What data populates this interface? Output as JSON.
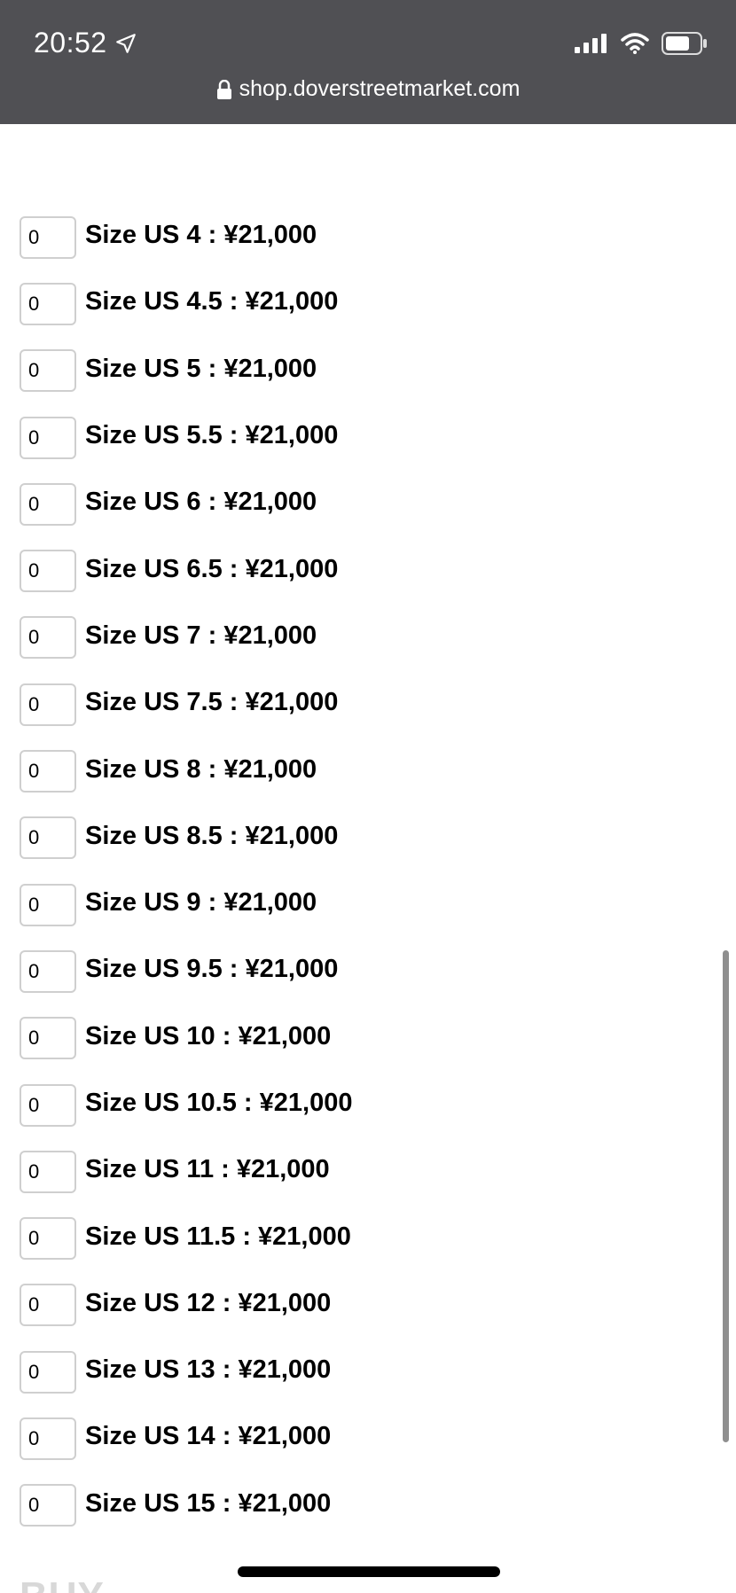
{
  "status_bar": {
    "time": "20:52"
  },
  "url_bar": {
    "url": "shop.doverstreetmarket.com"
  },
  "sizes": [
    {
      "qty": "0",
      "label": "Size US 4 : ¥21,000"
    },
    {
      "qty": "0",
      "label": "Size US 4.5 : ¥21,000"
    },
    {
      "qty": "0",
      "label": "Size US 5 : ¥21,000"
    },
    {
      "qty": "0",
      "label": "Size US 5.5 : ¥21,000"
    },
    {
      "qty": "0",
      "label": "Size US 6 : ¥21,000"
    },
    {
      "qty": "0",
      "label": "Size US 6.5 : ¥21,000"
    },
    {
      "qty": "0",
      "label": "Size US 7 : ¥21,000"
    },
    {
      "qty": "0",
      "label": "Size US 7.5 : ¥21,000"
    },
    {
      "qty": "0",
      "label": "Size US 8 : ¥21,000"
    },
    {
      "qty": "0",
      "label": "Size US 8.5 : ¥21,000"
    },
    {
      "qty": "0",
      "label": "Size US 9 : ¥21,000"
    },
    {
      "qty": "0",
      "label": "Size US 9.5 : ¥21,000"
    },
    {
      "qty": "0",
      "label": "Size US 10 : ¥21,000"
    },
    {
      "qty": "0",
      "label": "Size US 10.5 : ¥21,000"
    },
    {
      "qty": "0",
      "label": "Size US 11 : ¥21,000"
    },
    {
      "qty": "0",
      "label": "Size US 11.5 : ¥21,000"
    },
    {
      "qty": "0",
      "label": "Size US 12 : ¥21,000"
    },
    {
      "qty": "0",
      "label": "Size US 13 : ¥21,000"
    },
    {
      "qty": "0",
      "label": "Size US 14 : ¥21,000"
    },
    {
      "qty": "0",
      "label": "Size US 15 : ¥21,000"
    }
  ],
  "bottom": {
    "buy_label": "BUY"
  },
  "icons": {
    "location": "location-arrow-icon",
    "signal": "cellular-signal-icon",
    "wifi": "wifi-icon",
    "battery": "battery-icon",
    "lock": "lock-icon"
  },
  "colors": {
    "topbar_bg": "#505054",
    "input_border": "#cfcfcf",
    "text": "#000000"
  }
}
